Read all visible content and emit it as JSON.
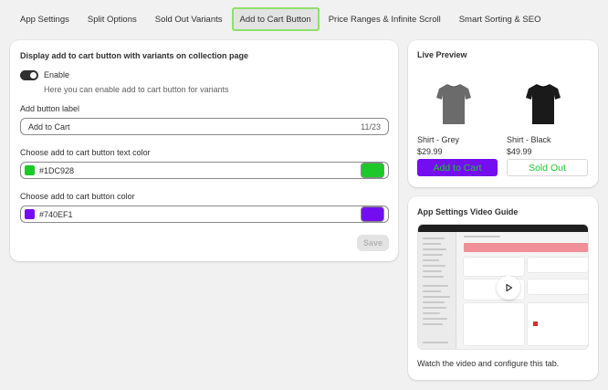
{
  "tabs": [
    {
      "label": "App Settings"
    },
    {
      "label": "Split Options"
    },
    {
      "label": "Sold Out Variants"
    },
    {
      "label": "Add to Cart Button"
    },
    {
      "label": "Price Ranges & Infinite Scroll"
    },
    {
      "label": "Smart Sorting & SEO"
    }
  ],
  "active_tab": "Add to Cart Button",
  "settings": {
    "title": "Display add to cart button with variants on collection page",
    "enable_label": "Enable",
    "enabled": true,
    "enable_help": "Here you can enable add to cart button for variants",
    "button_label_title": "Add button label",
    "button_label_value": "Add to Cart",
    "button_label_count": "11/23",
    "text_color_title": "Choose add to cart button text color",
    "text_color_value": "#1DC928",
    "button_color_title": "Choose add to cart button color",
    "button_color_value": "#740EF1",
    "save_label": "Save"
  },
  "preview": {
    "title": "Live Preview",
    "products": [
      {
        "name": "Shirt - Grey",
        "price": "$29.99",
        "button": "Add to Cart",
        "shirt_color": "#6b6b6b"
      },
      {
        "name": "Shirt - Black",
        "price": "$49.99",
        "button": "Sold Out",
        "shirt_color": "#1a1a1a"
      }
    ]
  },
  "video": {
    "title": "App Settings Video Guide",
    "caption": "Watch the video and configure this tab."
  },
  "colors": {
    "active_tab_border": "#8fe06a",
    "cart_text": "#1DC928",
    "cart_bg": "#740EF1",
    "sold_out_text": "#1DC928"
  }
}
